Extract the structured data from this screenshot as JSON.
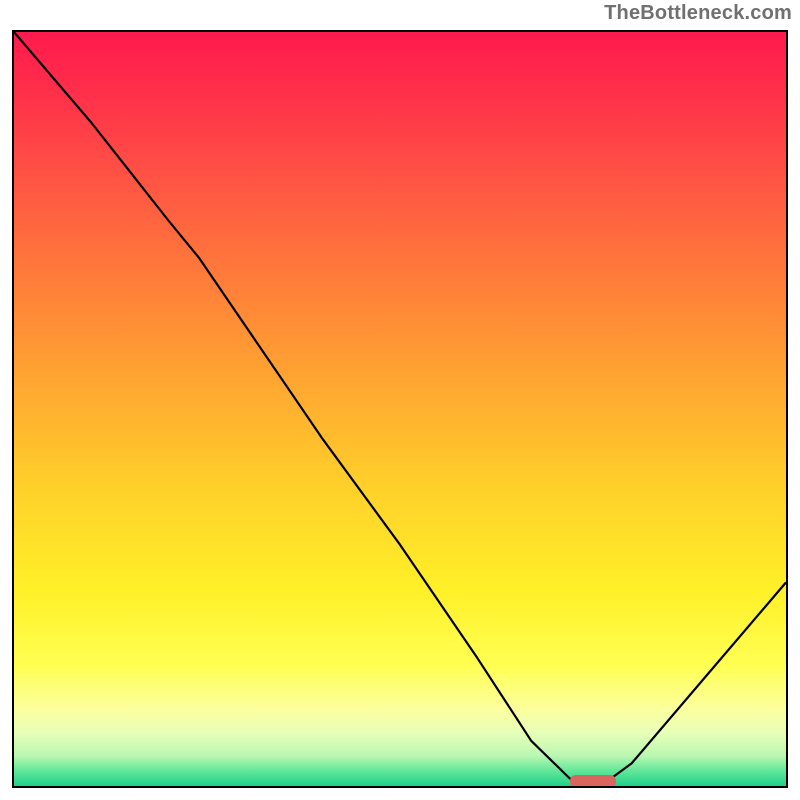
{
  "watermark": "TheBottleneck.com",
  "chart_data": {
    "type": "line",
    "title": "",
    "xlabel": "",
    "ylabel": "",
    "xlim": [
      0,
      100
    ],
    "ylim": [
      0,
      100
    ],
    "grid": false,
    "series": [
      {
        "name": "bottleneck-curve",
        "x": [
          0,
          10,
          20,
          24,
          30,
          40,
          50,
          60,
          67,
          72,
          76,
          80,
          90,
          100
        ],
        "y": [
          100,
          88,
          75,
          70,
          61,
          46,
          32,
          17,
          6,
          1,
          0,
          3,
          15,
          27
        ]
      }
    ],
    "marker": {
      "name": "optimal-range-marker",
      "x_start": 72,
      "x_end": 78,
      "y": 0.3,
      "color": "#d9655e"
    },
    "background": "rainbow-vertical-gradient"
  }
}
